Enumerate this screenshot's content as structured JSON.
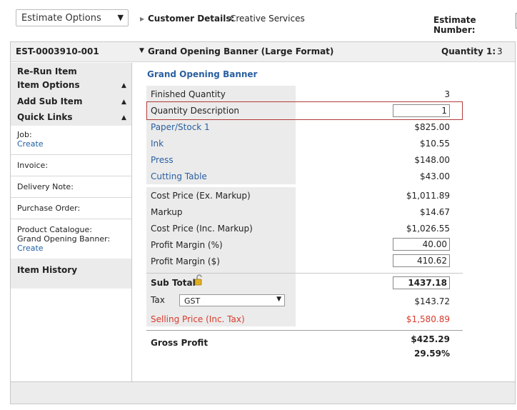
{
  "toolbar": {
    "estimate_options_label": "Estimate Options",
    "customer_details_label": "Customer Details:",
    "customer_name": "Creative Services",
    "estimate_number_label": "Estimate Number:"
  },
  "item_header": {
    "job_id": "EST-0003910-001",
    "item_title": "Grand Opening Banner (Large Format)",
    "quantity_label": "Quantity 1:",
    "quantity_value": "3"
  },
  "sidebar": {
    "rerun_item": "Re-Run Item",
    "item_options": "Item Options",
    "add_sub_item": "Add Sub Item",
    "quick_links": "Quick Links",
    "job_label": "Job:",
    "job_link": "Create",
    "invoice_label": "Invoice:",
    "delivery_note_label": "Delivery Note:",
    "purchase_order_label": "Purchase Order:",
    "product_catalogue_label": "Product Catalogue:",
    "product_catalogue_item": "Grand Opening Banner:",
    "product_catalogue_link": "Create",
    "item_history": "Item History"
  },
  "main": {
    "section_title": "Grand Opening Banner",
    "finished_quantity_label": "Finished Quantity",
    "finished_quantity_value": "3",
    "quantity_description_label": "Quantity Description",
    "quantity_description_value": "1",
    "costs": [
      {
        "label": "Paper/Stock 1",
        "value": "$825.00"
      },
      {
        "label": "Ink",
        "value": "$10.55"
      },
      {
        "label": "Press",
        "value": "$148.00"
      },
      {
        "label": "Cutting Table",
        "value": "$43.00"
      }
    ],
    "cost_price_ex_label": "Cost Price (Ex. Markup)",
    "cost_price_ex_value": "$1,011.89",
    "markup_label": "Markup",
    "markup_value": "$14.67",
    "cost_price_inc_label": "Cost Price (Inc. Markup)",
    "cost_price_inc_value": "$1,026.55",
    "profit_margin_pct_label": "Profit Margin (%)",
    "profit_margin_pct_value": "40.00",
    "profit_margin_dollar_label": "Profit Margin ($)",
    "profit_margin_dollar_value": "410.62",
    "sub_total_label": "Sub Total",
    "sub_total_value": "1437.18",
    "tax_label": "Tax",
    "tax_selected": "GST",
    "tax_value": "$143.72",
    "selling_price_label": "Selling Price (Inc. Tax)",
    "selling_price_value": "$1,580.89",
    "gross_profit_label": "Gross Profit",
    "gross_profit_value": "$425.29",
    "gross_profit_pct": "29.59%"
  },
  "colors": {
    "link_blue": "#2a5fa0",
    "selling_price_red": "#d93a2b",
    "highlight_border": "#b33a3a"
  }
}
